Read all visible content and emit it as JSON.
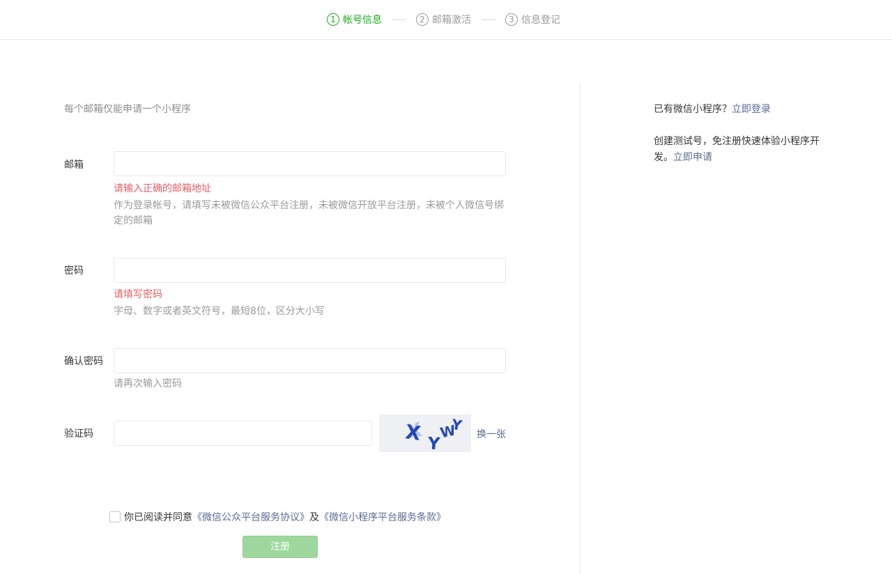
{
  "steps": [
    {
      "num": "1",
      "label": "帐号信息"
    },
    {
      "num": "2",
      "label": "邮箱激活"
    },
    {
      "num": "3",
      "label": "信息登记"
    }
  ],
  "tip": "每个邮箱仅能申请一个小程序",
  "email": {
    "label": "邮箱",
    "value": "",
    "error": "请输入正确的邮箱地址",
    "hint": "作为登录帐号，请填写未被微信公众平台注册，未被微信开放平台注册，未被个人微信号绑定的邮箱"
  },
  "password": {
    "label": "密码",
    "value": "",
    "error": "请填写密码",
    "hint": "字母、数字或者英文符号，最短8位，区分大小写"
  },
  "confirm": {
    "label": "确认密码",
    "value": "",
    "hint": "请再次输入密码"
  },
  "captcha": {
    "label": "验证码",
    "value": "",
    "text": "XYWY",
    "refresh": "换一张"
  },
  "agree": {
    "prefix": "你已阅读并同意",
    "link1": "《微信公众平台服务协议》",
    "and": "及",
    "link2": "《微信小程序平台服务条款》"
  },
  "submit_label": "注册",
  "side": {
    "has_app": "已有微信小程序？",
    "login_link": "立即登录",
    "test_text": "创建测试号，免注册快速体验小程序开发。",
    "apply_link": "立即申请"
  },
  "colors": {
    "accent": "#1aad19",
    "link": "#576b95",
    "error": "#e15f63",
    "button_disabled": "#9fd89e"
  }
}
